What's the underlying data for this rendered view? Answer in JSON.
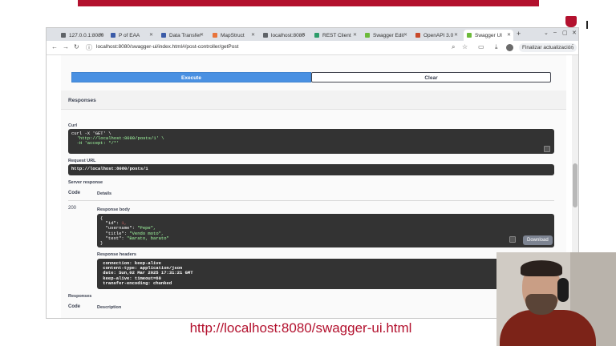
{
  "browser": {
    "tabs": [
      {
        "label": "127.0.0.1:8080",
        "color": "#5f6368"
      },
      {
        "label": "P of EAA",
        "color": "#3b5ba8"
      },
      {
        "label": "Data Transfer",
        "color": "#3b5ba8"
      },
      {
        "label": "MapStruct",
        "color": "#e8743b"
      },
      {
        "label": "localhost:8080",
        "color": "#5f6368"
      },
      {
        "label": "REST Client",
        "color": "#2e9c6a"
      },
      {
        "label": "Swagger Edit",
        "color": "#6cba3a"
      },
      {
        "label": "OpenAPI 3.0",
        "color": "#c94a2a"
      },
      {
        "label": "Swagger UI",
        "color": "#6cba3a"
      }
    ],
    "url": "localhost:8080/swagger-ui/index.html#/post-controller/getPost",
    "update_label": "Finalizar actualización"
  },
  "swagger": {
    "execute_label": "Execute",
    "clear_label": "Clear",
    "responses_title": "Responses",
    "curl_label": "Curl",
    "curl_lines": [
      "curl -X 'GET' \\",
      "  'http://localhost:8080/posts/1' \\",
      "  -H 'accept: */*'"
    ],
    "request_url_label": "Request URL",
    "request_url": "http://localhost:8080/posts/1",
    "server_response_label": "Server response",
    "code_col": "Code",
    "details_col": "Details",
    "status_code": "200",
    "response_body_label": "Response body",
    "response_body": {
      "open": "{",
      "id_key": "  \"id\": ",
      "id_val": "1,",
      "username_key": "  \"username\": ",
      "username_val": "\"Pepe\",",
      "title_key": "  \"title\": ",
      "title_val": "\"Vendo moto\",",
      "text_key": "  \"text\": ",
      "text_val": "\"Barato, barato\"",
      "close": "}"
    },
    "download_label": "Download",
    "response_headers_label": "Response headers",
    "response_headers": [
      " connection: keep-alive",
      " content-type: application/json",
      " date: Sun,02 Mar 2025 17:31:21 GMT",
      " keep-alive: timeout=60",
      " transfer-encoding: chunked"
    ],
    "responses_label_2": "Responses",
    "code_col_2": "Code",
    "description_col": "Description"
  },
  "caption": "http://localhost:8080/swagger-ui.html",
  "colors": {
    "brand_red": "#b3112e",
    "execute_blue": "#4990e2",
    "code_bg": "#333333",
    "json_string": "#a2fca2"
  }
}
